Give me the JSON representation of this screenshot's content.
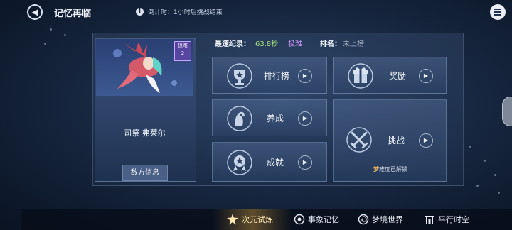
{
  "header": {
    "title": "记忆再临",
    "info_icon": "i",
    "countdown": "倒计时：1小时后挑战结束"
  },
  "character": {
    "name": "司祭 弗莱尔",
    "difficulty_badge_line1": "极难",
    "difficulty_badge_line2": "2",
    "enemy_info_button": "敌方信息"
  },
  "stats": {
    "best_record_label": "最速纪录：",
    "best_record_value": "63.8秒",
    "best_record_difficulty": "极难",
    "rank_label": "排名：",
    "rank_value": "未上榜"
  },
  "menu": {
    "leaderboard": "排行榜",
    "rewards": "奖励",
    "cultivate": "养成",
    "achievements": "成就",
    "challenge": "挑战",
    "dream_tag": "梦",
    "unlock_note": "难度已解锁",
    "arrow": "▶"
  },
  "bottom_nav": [
    {
      "label": "次元试炼",
      "icon": "star-burst-icon"
    },
    {
      "label": "事象记忆",
      "icon": "orb-icon"
    },
    {
      "label": "梦境世界",
      "icon": "spiral-icon"
    },
    {
      "label": "平行时空",
      "icon": "gate-icon"
    }
  ],
  "colors": {
    "accent_green": "#a5e27d",
    "accent_purple": "#d39bff",
    "active_nav": "#ffe7b0"
  }
}
